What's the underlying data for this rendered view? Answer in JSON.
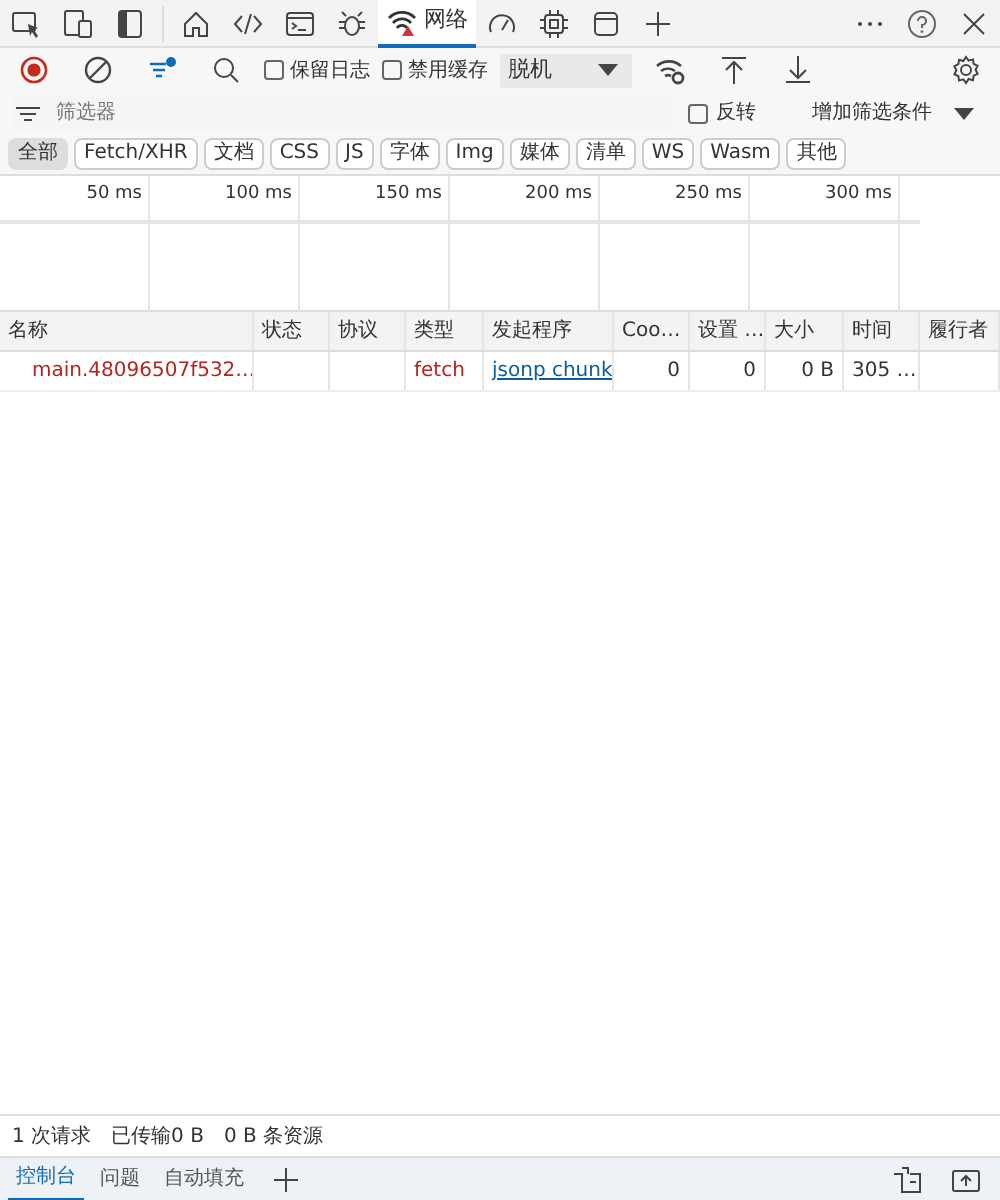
{
  "top_tabs": [
    {
      "kind": "inspect",
      "selected": false
    },
    {
      "kind": "device",
      "selected": false
    },
    {
      "kind": "dock",
      "selected": false
    },
    {
      "kind": "home",
      "selected": false
    },
    {
      "kind": "code",
      "selected": false
    },
    {
      "kind": "console",
      "selected": false
    },
    {
      "kind": "bug",
      "selected": false
    },
    {
      "kind": "network",
      "label": "网络",
      "selected": true
    },
    {
      "kind": "gauge",
      "selected": false
    },
    {
      "kind": "chip",
      "selected": false
    },
    {
      "kind": "window",
      "selected": false
    },
    {
      "kind": "plus",
      "selected": false
    }
  ],
  "toolbar": {
    "recording": true,
    "preserve_log": {
      "label": "保留日志",
      "checked": false
    },
    "disable_cache": {
      "label": "禁用缓存",
      "checked": false
    },
    "throttle": "脱机"
  },
  "filter": {
    "placeholder": "筛选器",
    "invert": {
      "label": "反转",
      "checked": false
    },
    "more_filters": "增加筛选条件"
  },
  "type_filters": [
    {
      "label": "全部",
      "selected": true
    },
    {
      "label": "Fetch/XHR",
      "selected": false
    },
    {
      "label": "文档",
      "selected": false
    },
    {
      "label": "CSS",
      "selected": false
    },
    {
      "label": "JS",
      "selected": false
    },
    {
      "label": "字体",
      "selected": false
    },
    {
      "label": "Img",
      "selected": false
    },
    {
      "label": "媒体",
      "selected": false
    },
    {
      "label": "清单",
      "selected": false
    },
    {
      "label": "WS",
      "selected": false
    },
    {
      "label": "Wasm",
      "selected": false
    },
    {
      "label": "其他",
      "selected": false
    }
  ],
  "timeline_ticks": [
    "50 ms",
    "100 ms",
    "150 ms",
    "200 ms",
    "250 ms",
    "300 ms"
  ],
  "table": {
    "columns": [
      "名称",
      "状态",
      "协议",
      "类型",
      "发起程序",
      "Coo…",
      "设置 …",
      "大小",
      "时间",
      "履行者"
    ],
    "rows": [
      {
        "cells": [
          "main.48096507f532…",
          "",
          "",
          "fetch",
          "jsonp chunk",
          "0",
          "0",
          "0 B",
          "305 …",
          ""
        ],
        "failed": true
      }
    ]
  },
  "status_bar": [
    "1 次请求",
    "已传输0 B",
    "0 B 条资源"
  ],
  "drawer_tabs": [
    {
      "label": "控制台",
      "selected": true
    },
    {
      "label": "问题",
      "selected": false
    },
    {
      "label": "自动填充",
      "selected": false
    }
  ]
}
